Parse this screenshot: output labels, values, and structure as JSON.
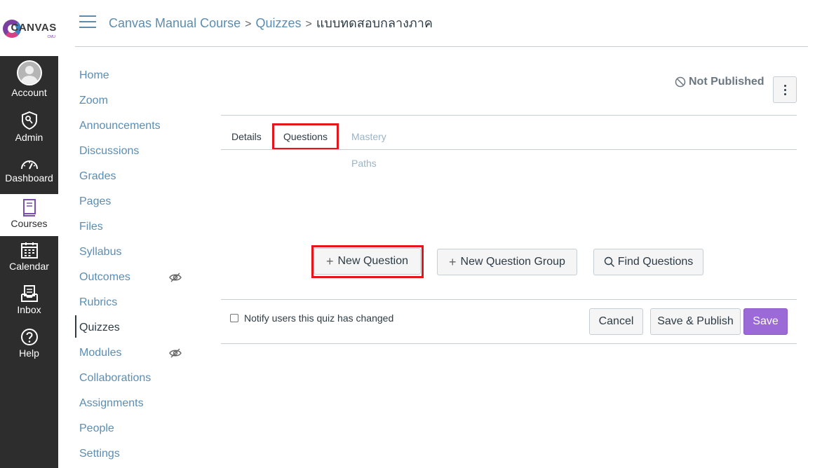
{
  "logo": {
    "text": "CANVAS",
    "sub": "CMU"
  },
  "global_nav": {
    "items": [
      {
        "label": "Account",
        "icon": "avatar-icon"
      },
      {
        "label": "Admin",
        "icon": "admin-shield-icon"
      },
      {
        "label": "Dashboard",
        "icon": "dashboard-gauge-icon"
      },
      {
        "label": "Courses",
        "icon": "courses-book-icon",
        "active": true
      },
      {
        "label": "Calendar",
        "icon": "calendar-icon"
      },
      {
        "label": "Inbox",
        "icon": "inbox-icon"
      },
      {
        "label": "Help",
        "icon": "help-icon"
      }
    ]
  },
  "breadcrumb": {
    "items": [
      "Canvas Manual Course",
      "Quizzes",
      "แบบทดสอบกลางภาค"
    ],
    "separator": ">"
  },
  "course_nav": {
    "items": [
      {
        "label": "Home"
      },
      {
        "label": "Zoom"
      },
      {
        "label": "Announcements"
      },
      {
        "label": "Discussions"
      },
      {
        "label": "Grades"
      },
      {
        "label": "Pages"
      },
      {
        "label": "Files"
      },
      {
        "label": "Syllabus"
      },
      {
        "label": "Outcomes",
        "hidden_icon": "eye-slash-icon"
      },
      {
        "label": "Rubrics"
      },
      {
        "label": "Quizzes",
        "active": true
      },
      {
        "label": "Modules",
        "hidden_icon": "eye-slash-icon"
      },
      {
        "label": "Collaborations"
      },
      {
        "label": "Assignments"
      },
      {
        "label": "People"
      },
      {
        "label": "Settings"
      }
    ]
  },
  "quiz": {
    "publish_status": "Not Published",
    "tabs": [
      "Details",
      "Questions",
      "Mastery Paths"
    ],
    "active_tab": "Questions",
    "actions": {
      "new_question": "New Question",
      "new_question_group": "New Question Group",
      "find_questions": "Find Questions"
    },
    "notify_label": "Notify users this quiz has changed",
    "notify_checked": false,
    "footer_buttons": {
      "cancel": "Cancel",
      "save_publish": "Save & Publish",
      "save": "Save"
    }
  },
  "colors": {
    "nav_bg": "#2d2d2d",
    "link": "#5b8db3",
    "highlight_box": "#e3161b",
    "primary_button": "#9b6ad6"
  }
}
